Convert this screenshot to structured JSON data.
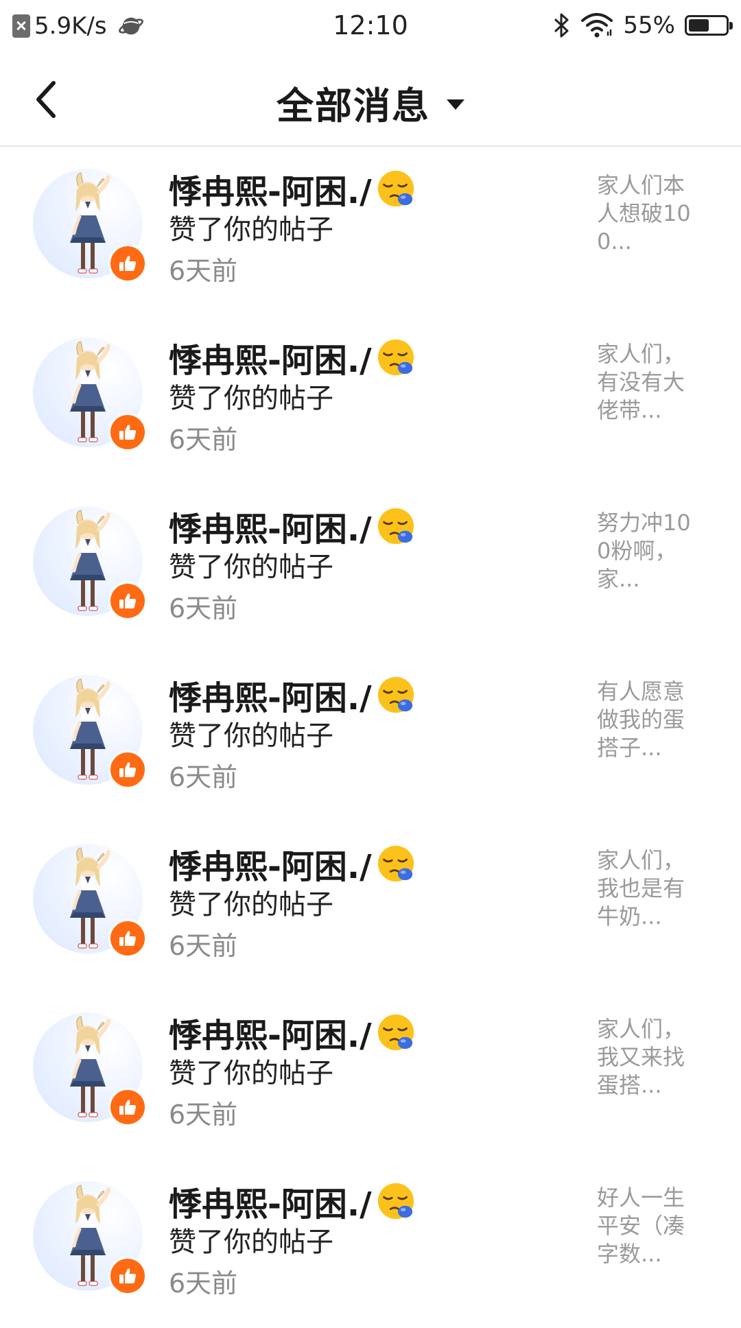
{
  "status_bar": {
    "network_speed": "5.9K/s",
    "time": "12:10",
    "battery": "55%",
    "battery_level": 0.55,
    "icons": [
      "close-box-icon",
      "planet-icon",
      "bluetooth-icon",
      "wifi-icon",
      "battery-icon"
    ]
  },
  "header": {
    "title": "全部消息",
    "icons": [
      "back-icon",
      "dropdown-caret-icon"
    ]
  },
  "colors": {
    "like_badge": "#ff6a13",
    "secondary_text": "#8a8a8a",
    "divider": "#e6e6e6"
  },
  "messages": [
    {
      "name": "悸冉熙-阿困./",
      "emoji": "sleepy-face-icon",
      "action": "赞了你的帖子",
      "time": "6天前",
      "preview": "家人们本人想破100..."
    },
    {
      "name": "悸冉熙-阿困./",
      "emoji": "sleepy-face-icon",
      "action": "赞了你的帖子",
      "time": "6天前",
      "preview": "家人们，有没有大佬带..."
    },
    {
      "name": "悸冉熙-阿困./",
      "emoji": "sleepy-face-icon",
      "action": "赞了你的帖子",
      "time": "6天前",
      "preview": "努力冲100粉啊，家..."
    },
    {
      "name": "悸冉熙-阿困./",
      "emoji": "sleepy-face-icon",
      "action": "赞了你的帖子",
      "time": "6天前",
      "preview": "有人愿意做我的蛋搭子..."
    },
    {
      "name": "悸冉熙-阿困./",
      "emoji": "sleepy-face-icon",
      "action": "赞了你的帖子",
      "time": "6天前",
      "preview": "家人们，我也是有牛奶..."
    },
    {
      "name": "悸冉熙-阿困./",
      "emoji": "sleepy-face-icon",
      "action": "赞了你的帖子",
      "time": "6天前",
      "preview": "家人们，我又来找蛋搭..."
    },
    {
      "name": "悸冉熙-阿困./",
      "emoji": "sleepy-face-icon",
      "action": "赞了你的帖子",
      "time": "6天前",
      "preview": "好人一生平安（凑字数..."
    }
  ]
}
